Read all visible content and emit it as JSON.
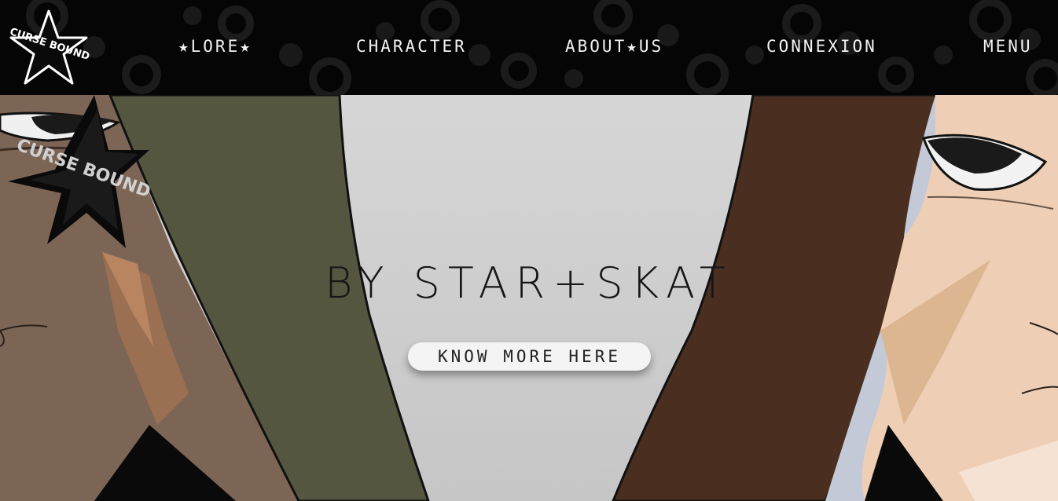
{
  "header": {
    "logo_text": "CURSE BOUND",
    "nav": [
      {
        "id": "lore",
        "label": "★LORE★"
      },
      {
        "id": "character",
        "label": "CHARACTER"
      },
      {
        "id": "about",
        "label": "ABOUT★US"
      },
      {
        "id": "connexion",
        "label": "CONNEXION"
      },
      {
        "id": "menu",
        "label": "MENU"
      }
    ]
  },
  "hero": {
    "logo_text": "CURSE BOUND",
    "tagline": "BY STAR+SKAT",
    "cta_label": "KNOW MORE HERE"
  },
  "colors": {
    "navbar_bg": "#050505",
    "nav_text": "#f2f2f2",
    "hero_bg": "#cfcfcf",
    "left_character_skin": "#7d6556",
    "left_character_hood": "#55563f",
    "right_character_hood": "#4a2e1f",
    "right_character_skin": "#eecfb5",
    "cta_bg": "#f4f4f4"
  }
}
